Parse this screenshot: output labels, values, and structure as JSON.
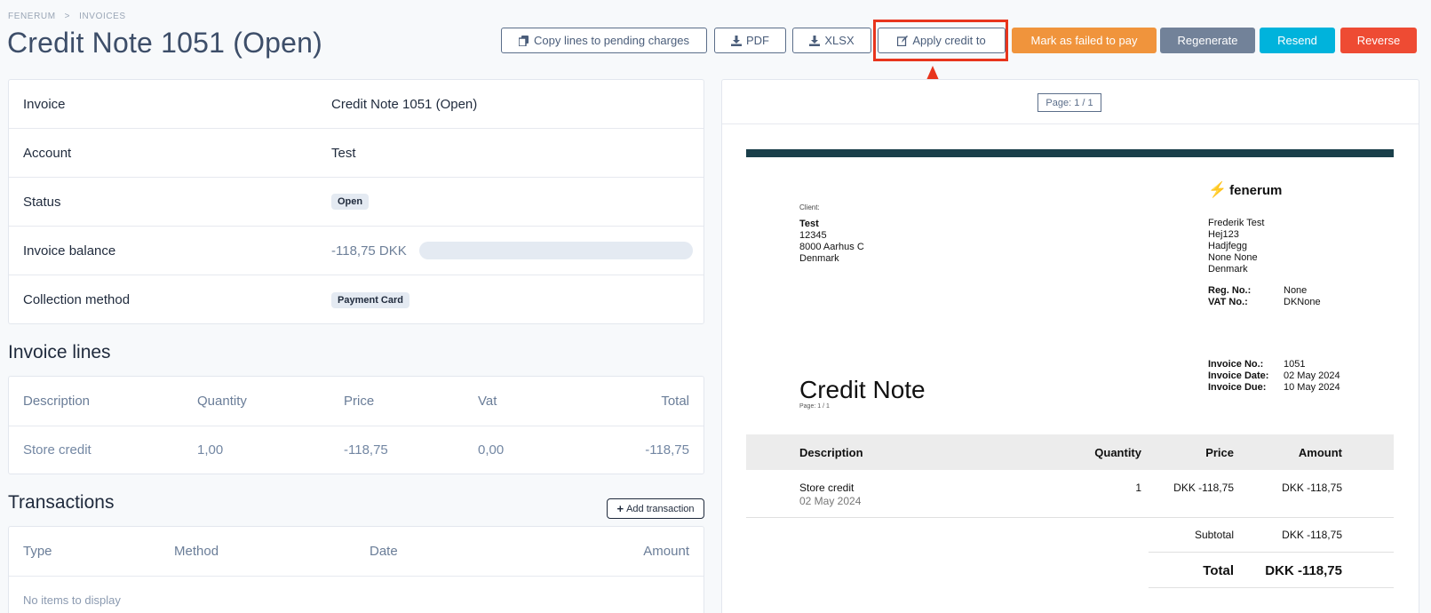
{
  "breadcrumb": {
    "root": "FENERUM",
    "separator": ">",
    "current": "INVOICES"
  },
  "page_title": "Credit Note 1051 (Open)",
  "toolbar": {
    "copy_lines": "Copy lines to pending charges",
    "pdf": "PDF",
    "xlsx": "XLSX",
    "apply_credit": "Apply credit to",
    "mark_failed": "Mark as failed to pay",
    "regenerate": "Regenerate",
    "resend": "Resend",
    "reverse": "Reverse"
  },
  "colors": {
    "mark_failed": "#f0943c",
    "regenerate": "#728299",
    "resend": "#00b3dc",
    "reverse": "#ee4b33",
    "highlight": "#e8351d"
  },
  "details": {
    "invoice_label": "Invoice",
    "invoice_value": "Credit Note 1051 (Open)",
    "account_label": "Account",
    "account_value": "Test",
    "status_label": "Status",
    "status_value": "Open",
    "balance_label": "Invoice balance",
    "balance_value": "-118,75 DKK",
    "balance_paid_fraction": 0,
    "collection_label": "Collection method",
    "collection_value": "Payment Card"
  },
  "invoice_lines": {
    "title": "Invoice lines",
    "headers": [
      "Description",
      "Quantity",
      "Price",
      "Vat",
      "Total"
    ],
    "rows": [
      [
        "Store credit",
        "1,00",
        "-118,75",
        "0,00",
        "-118,75"
      ]
    ]
  },
  "transactions": {
    "title": "Transactions",
    "add_label": "Add transaction",
    "headers": [
      "Type",
      "Method",
      "Date",
      "Amount"
    ],
    "empty": "No items to display"
  },
  "preview": {
    "page_indicator": "Page: 1 / 1",
    "client_label": "Client:",
    "client": {
      "name": "Test",
      "line1": "12345",
      "line2": "8000 Aarhus C",
      "line3": "Denmark"
    },
    "brand": "fenerum",
    "sender": {
      "name": "Frederik Test",
      "line1": "Hej123",
      "line2": "Hadjfegg",
      "line3": "None None",
      "line4": "Denmark"
    },
    "reg_no_label": "Reg. No.:",
    "reg_no": "None",
    "vat_no_label": "VAT No.:",
    "vat_no": "DKNone",
    "invoice_no_label": "Invoice No.:",
    "invoice_no": "1051",
    "invoice_date_label": "Invoice Date:",
    "invoice_date": "02 May 2024",
    "invoice_due_label": "Invoice Due:",
    "invoice_due": "10 May 2024",
    "doc_title": "Credit Note",
    "doc_page": "Page: 1 / 1",
    "headers": {
      "description": "Description",
      "quantity": "Quantity",
      "price": "Price",
      "amount": "Amount"
    },
    "line": {
      "description": "Store credit",
      "date": "02 May 2024",
      "quantity": "1",
      "price": "DKK -118,75",
      "amount": "DKK -118,75"
    },
    "subtotal_label": "Subtotal",
    "subtotal": "DKK -118,75",
    "total_label": "Total",
    "total": "DKK -118,75"
  }
}
